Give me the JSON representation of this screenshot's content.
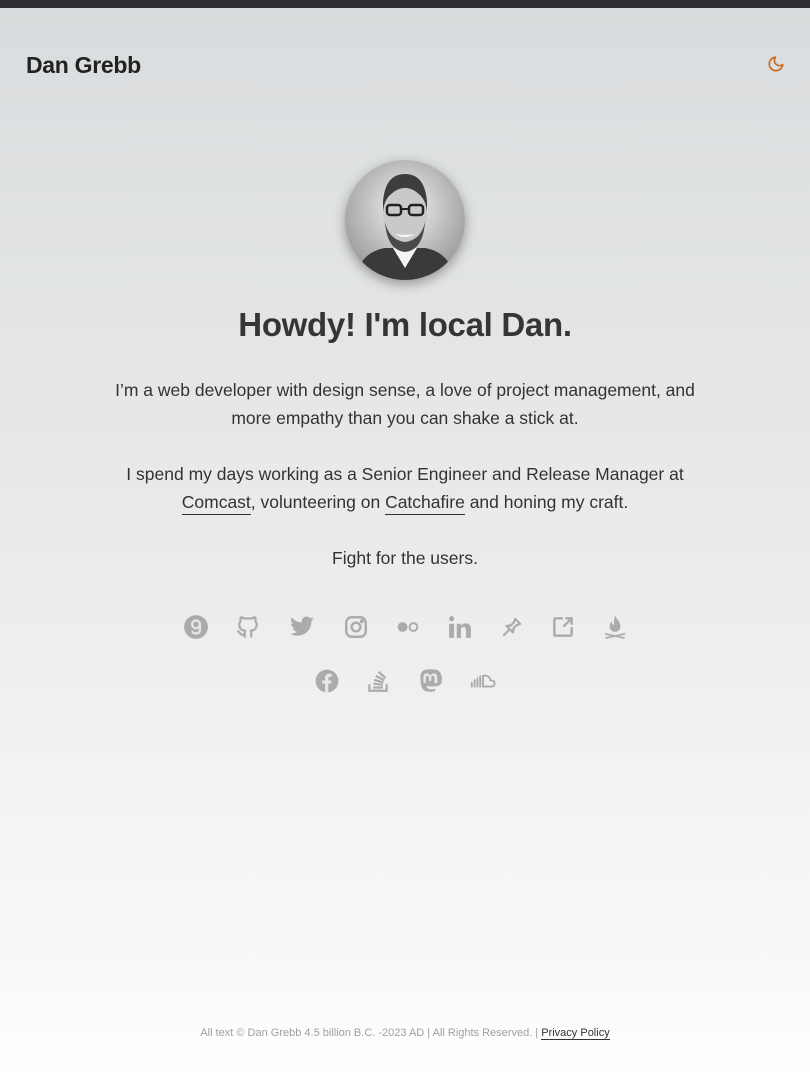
{
  "header": {
    "site_title": "Dan Grebb",
    "theme_toggle_icon": "moon-icon",
    "accent_color": "#c86a1e"
  },
  "hero": {
    "headline": "Howdy! I'm local Dan.",
    "intro": "I’m a web developer with design sense, a love of project management, and more empathy than you can shake a stick at.",
    "work_prefix": "I spend my days working as a Senior Engineer and Release Manager at ",
    "work_link_1": "Comcast",
    "work_middle": ", volunteering on ",
    "work_link_2": "Catchafire",
    "work_suffix": " and honing my craft.",
    "motto": "Fight for the users."
  },
  "social": {
    "icon_color": "#a9abad",
    "row1": [
      "gravatar-icon",
      "github-icon",
      "twitter-icon",
      "instagram-icon",
      "flickr-icon",
      "linkedin-icon",
      "pin-icon",
      "external-link-icon",
      "campfire-icon"
    ],
    "row2": [
      "facebook-icon",
      "stack-overflow-icon",
      "mastodon-icon",
      "soundcloud-icon"
    ]
  },
  "footer": {
    "copyright": "All text © Dan Grebb 4.5 billion B.C. -2023 AD | All Rights Reserved. |",
    "privacy_link": "Privacy Policy"
  }
}
